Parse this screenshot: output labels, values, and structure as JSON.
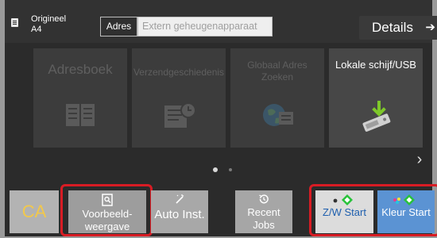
{
  "header": {
    "original_label": "Origineel",
    "original_size": "A4",
    "address_label": "Adres",
    "address_placeholder": "Extern geheugenapparaat",
    "details_label": "Details",
    "details_arrow": "➔"
  },
  "tiles": [
    {
      "label": "Adresboek",
      "icon": "address-book-icon",
      "enabled": false
    },
    {
      "label": "Verzendgeschiedenis",
      "icon": "send-history-icon",
      "enabled": false
    },
    {
      "label": "Globaal Adres Zoeken",
      "icon": "global-address-search-icon",
      "enabled": false
    },
    {
      "label": "Lokale schijf/USB",
      "icon": "local-drive-usb-icon",
      "enabled": true
    }
  ],
  "pager": {
    "current": 1,
    "total": 2,
    "next_glyph": "›"
  },
  "bottom": {
    "ca_label": "CA",
    "preview_label": "Voorbeeld-weergave",
    "auto_label": "Auto Inst.",
    "recent_label": "Recent Jobs",
    "bw_label": "Z/W Start",
    "color_label": "Kleur Start"
  },
  "colors": {
    "accent_yellow": "#f2c84b",
    "highlight_red": "#d81c24",
    "start_blue": "#5b93d3",
    "start_green": "#28c23a"
  }
}
